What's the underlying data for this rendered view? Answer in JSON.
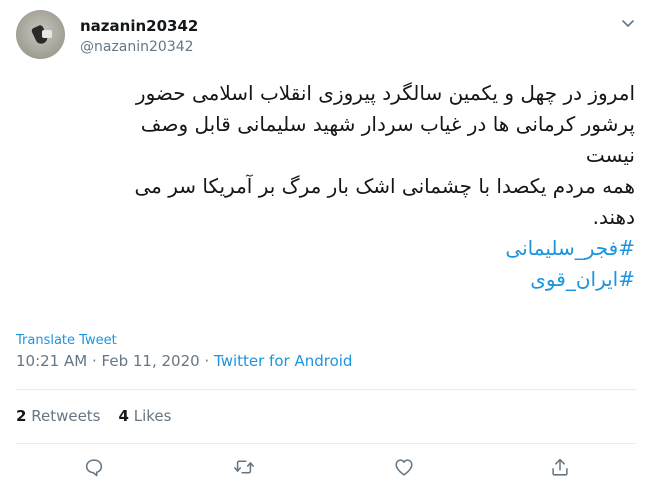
{
  "author": {
    "display_name": "nazanin20342",
    "handle": "@nazanin20342"
  },
  "tweet": {
    "lines": [
      "امروز در چهل و یکمین سالگرد پیروزی انقلاب اسلامی حضور",
      "پرشور کرمانی ها در غیاب سردار شهید سلیمانی قابل وصف",
      "نیست",
      "همه مردم یکصدا با چشمانی اشک بار مرگ بر آمریکا سر می",
      "دهند."
    ],
    "hashtags": [
      "#فجر_سلیمانی",
      "#ایران_قوی"
    ]
  },
  "translate_label": "Translate Tweet",
  "meta": {
    "time": "10:21 AM",
    "separator": "·",
    "date": "Feb 11, 2020",
    "source": "Twitter for Android"
  },
  "stats": {
    "retweets_count": "2",
    "retweets_label": "Retweets",
    "likes_count": "4",
    "likes_label": "Likes"
  },
  "icons": {
    "reply": "reply-icon",
    "retweet": "retweet-icon",
    "like": "heart-icon",
    "share": "share-icon",
    "more": "chevron-down-icon"
  },
  "colors": {
    "link": "#1b95e0",
    "secondary": "#657786",
    "text": "#14171a",
    "divider": "#e6ecf0"
  }
}
